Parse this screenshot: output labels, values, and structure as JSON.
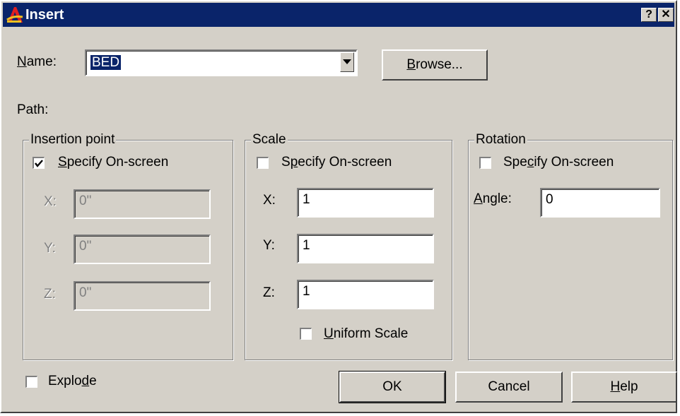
{
  "window": {
    "title": "Insert",
    "help_glyph": "?",
    "close_glyph": "✕"
  },
  "name": {
    "label": "Name:",
    "value": "BED",
    "browse_label": "Browse..."
  },
  "path": {
    "label": "Path:"
  },
  "insertion": {
    "title": "Insertion point",
    "specify_label": "Specify On-screen",
    "specify_checked": true,
    "x_label": "X:",
    "x_value": "0\"",
    "y_label": "Y:",
    "y_value": "0\"",
    "z_label": "Z:",
    "z_value": "0\""
  },
  "scale": {
    "title": "Scale",
    "specify_label": "Specify On-screen",
    "specify_checked": false,
    "x_label": "X:",
    "x_value": "1",
    "y_label": "Y:",
    "y_value": "1",
    "z_label": "Z:",
    "z_value": "1",
    "uniform_label": "Uniform Scale",
    "uniform_checked": false
  },
  "rotation": {
    "title": "Rotation",
    "specify_label": "Specify On-screen",
    "specify_checked": false,
    "angle_label": "Angle:",
    "angle_value": "0"
  },
  "explode": {
    "label": "Explode",
    "checked": false
  },
  "buttons": {
    "ok": "OK",
    "cancel": "Cancel",
    "help": "Help"
  }
}
